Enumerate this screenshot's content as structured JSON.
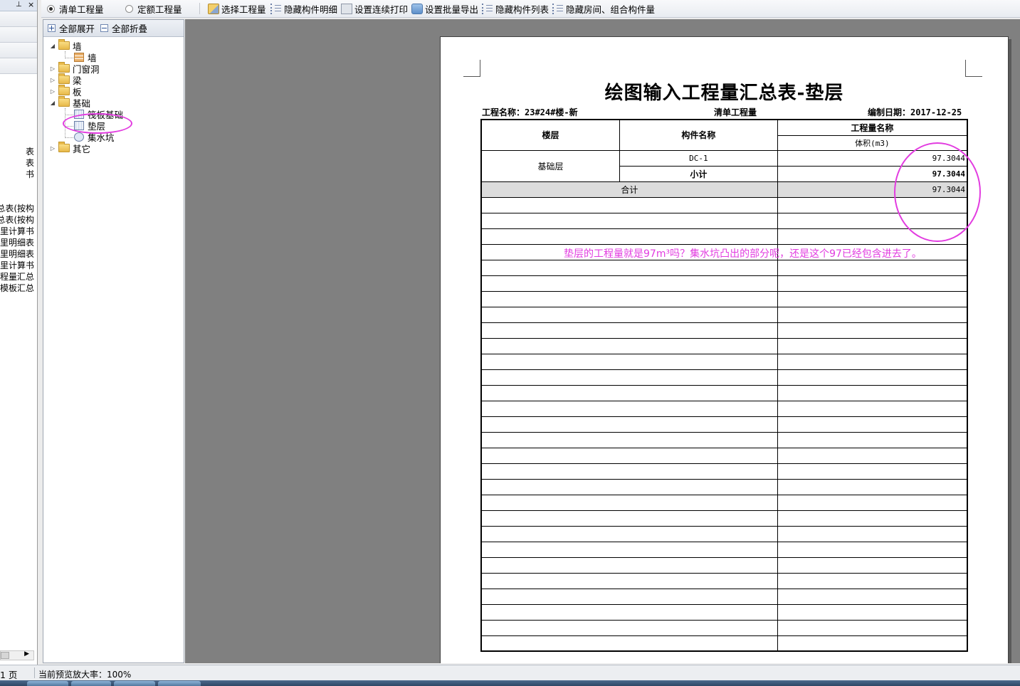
{
  "left_panel": {
    "pin_glyph": "⊥",
    "close_glyph": "×",
    "partial_items": [
      "表",
      "表",
      "书",
      "总表(按构",
      "总表(按构",
      "里计算书",
      "里明细表",
      "里明细表",
      "里计算书",
      "程量汇总",
      "模板汇总"
    ]
  },
  "toolbar": {
    "radio_bill": "清单工程量",
    "radio_quota": "定额工程量",
    "select_quantity": "选择工程量",
    "hide_component_detail": "隐藏构件明细",
    "set_continuous_print": "设置连续打印",
    "set_batch_export": "设置批量导出",
    "hide_component_list": "隐藏构件列表",
    "hide_room_combo": "隐藏房间、组合构件量"
  },
  "tree": {
    "expand_all": "全部展开",
    "collapse_all": "全部折叠",
    "nodes": {
      "wall_group": "墙",
      "wall_leaf": "墙",
      "door_window": "门窗洞",
      "beam": "梁",
      "slab": "板",
      "foundation": "基础",
      "raft_foundation": "筏板基础",
      "cushion": "垫层",
      "sump_pit": "集水坑",
      "other": "其它"
    }
  },
  "report": {
    "title": "绘图输入工程量汇总表-垫层",
    "project_name": "工程名称：23#24#楼-新",
    "mode": "清单工程量",
    "date": "编制日期：2017-12-25",
    "headers": {
      "floor": "楼层",
      "component_name": "构件名称",
      "quantity_name": "工程量名称",
      "volume_unit": "体积(m3)"
    },
    "rows": {
      "floor": "基础层",
      "component": "DC-1",
      "component_value": "97.3044",
      "subtotal_label": "小计",
      "subtotal_value": "97.3044",
      "total_label": "合计",
      "total_value": "97.3044"
    },
    "empty_row_count": 29
  },
  "annotation": {
    "question": "垫层的工程量就是97m³吗？集水坑凸出的部分呢，还是这个97已经包含进去了。",
    "color": "#e23ce0"
  },
  "status": {
    "page": "1 页",
    "zoom": "当前预览放大率：100%"
  }
}
